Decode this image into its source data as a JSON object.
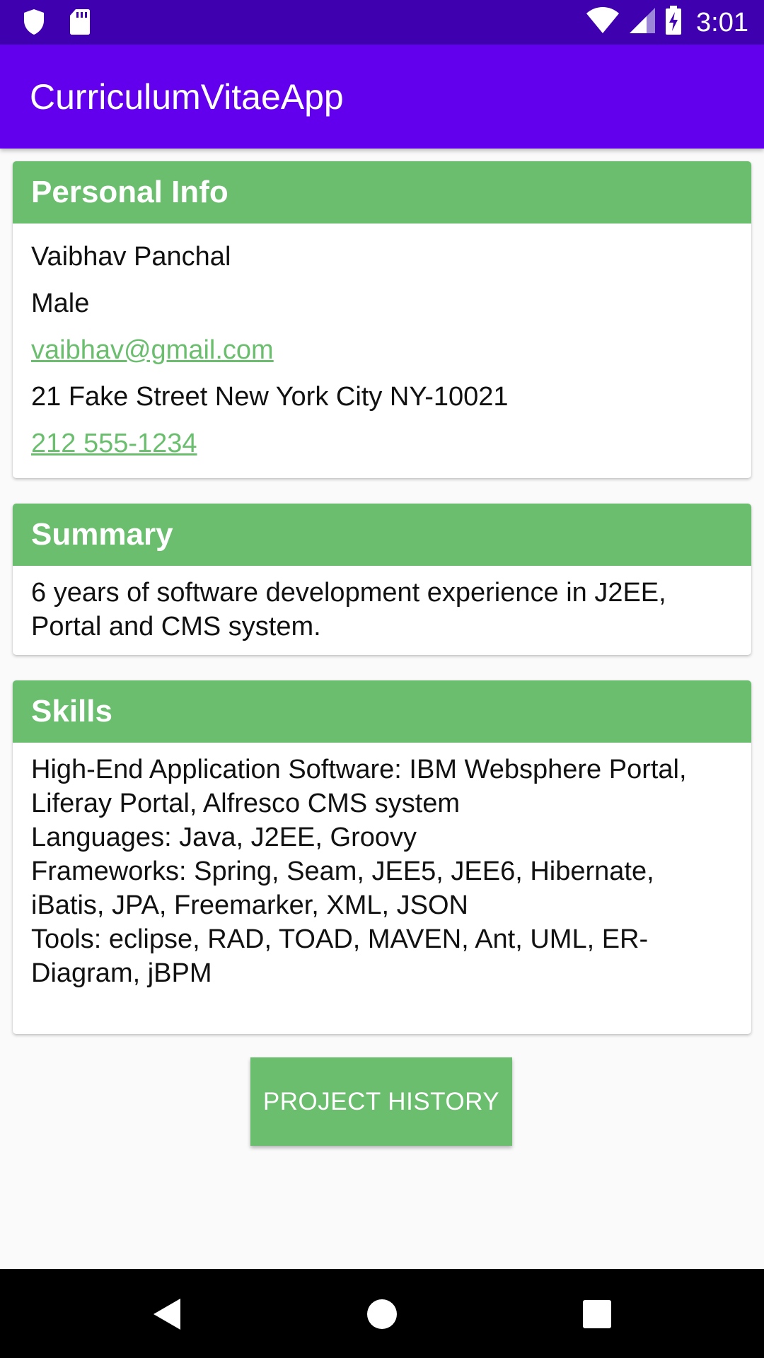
{
  "status_bar": {
    "time": "3:01",
    "icons": [
      "shield-icon",
      "sd-card-icon",
      "wifi-icon",
      "signal-icon",
      "battery-charging-icon"
    ]
  },
  "app_bar": {
    "title": "CurriculumVitaeApp"
  },
  "personal_info": {
    "header": "Personal Info",
    "name": "Vaibhav Panchal",
    "gender": "Male",
    "email": "vaibhav@gmail.com",
    "address": "21 Fake Street New York City NY-10021",
    "phone": "212 555-1234"
  },
  "summary": {
    "header": "Summary",
    "text": "6 years of software development experience in J2EE, Portal and CMS system."
  },
  "skills": {
    "header": "Skills",
    "text": "High-End Application Software: IBM Websphere Portal, Liferay Portal, Alfresco CMS system\nLanguages: Java, J2EE, Groovy\nFrameworks: Spring, Seam, JEE5, JEE6, Hibernate, iBatis, JPA, Freemarker, XML, JSON\nTools: eclipse, RAD, TOAD, MAVEN, Ant, UML, ER-Diagram, jBPM"
  },
  "project_history_button": {
    "label": "PROJECT HISTORY"
  },
  "nav_bar": {
    "icons": [
      "back-icon",
      "home-icon",
      "recents-icon"
    ]
  },
  "colors": {
    "status_bar": "#3f00b0",
    "app_bar": "#6200ee",
    "accent_green": "#6abe6e",
    "background": "#fafafa"
  }
}
